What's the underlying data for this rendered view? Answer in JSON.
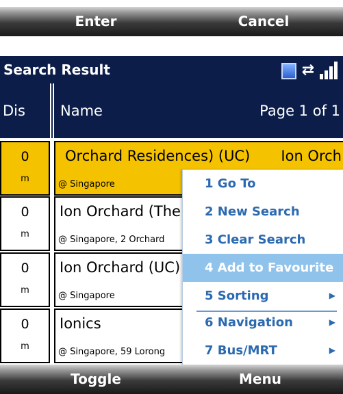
{
  "top_softkeys": {
    "left": "Enter",
    "right": "Cancel"
  },
  "title_bar": {
    "title": "Search Result"
  },
  "header": {
    "dis": "Dis",
    "name": "Name",
    "page": "Page 1 of 1"
  },
  "results": [
    {
      "distance": "0",
      "unit": "m",
      "name": "Orchard Residences) (UC)",
      "name_extra": "Ion Orch",
      "address": "@ Singapore",
      "selected": true
    },
    {
      "distance": "0",
      "unit": "m",
      "name": "Ion Orchard (The",
      "address": "@ Singapore, 2 Orchard",
      "selected": false
    },
    {
      "distance": "0",
      "unit": "m",
      "name": "Ion Orchard (UC)",
      "address": "@ Singapore",
      "selected": false
    },
    {
      "distance": "0",
      "unit": "m",
      "name": "Ionics",
      "address": "@ Singapore, 59 Lorong",
      "selected": false
    }
  ],
  "menu": {
    "items": [
      {
        "label": "1 Go To",
        "submenu": false,
        "active": false
      },
      {
        "label": "2 New Search",
        "submenu": false,
        "active": false
      },
      {
        "label": "3 Clear Search",
        "submenu": false,
        "active": false
      },
      {
        "label": "4 Add to Favourite",
        "submenu": false,
        "active": true
      },
      {
        "label": "5 Sorting",
        "submenu": true,
        "active": false
      },
      {
        "label": "6 Navigation",
        "submenu": true,
        "active": false
      },
      {
        "label": "7 Bus/MRT",
        "submenu": true,
        "active": false
      }
    ]
  },
  "bottom_softkeys": {
    "left": "Toggle",
    "right": "Menu"
  },
  "colors": {
    "title_bg": "#0c1d4a",
    "selection": "#f5c200",
    "menu_text": "#2c6ab0",
    "menu_active": "#8fc3ec"
  }
}
